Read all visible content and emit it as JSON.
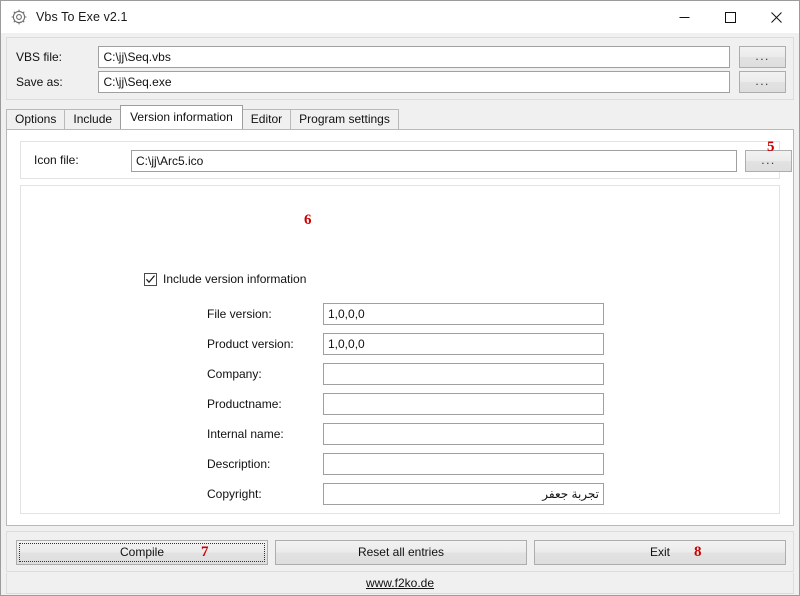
{
  "window": {
    "title": "Vbs To Exe v2.1",
    "icon": "gear-icon",
    "minimize_label": "–",
    "maximize_label": "□",
    "close_label": "✕"
  },
  "top": {
    "vbs_file_label": "VBS file:",
    "vbs_file_value": "C:\\jj\\Seq.vbs",
    "vbs_browse_label": "...",
    "save_as_label": "Save as:",
    "save_as_value": "C:\\jj\\Seq.exe",
    "save_browse_label": "..."
  },
  "tabs": [
    {
      "label": "Options",
      "selected": false
    },
    {
      "label": "Include",
      "selected": false
    },
    {
      "label": "Version information",
      "selected": true
    },
    {
      "label": "Editor",
      "selected": false
    },
    {
      "label": "Program settings",
      "selected": false
    }
  ],
  "version_tab": {
    "icon_file_label": "Icon file:",
    "icon_file_value": "C:\\jj\\Arc5.ico",
    "icon_browse_label": "...",
    "include_version_label": "Include version information",
    "include_version_checked": true,
    "fields": [
      {
        "label": "File version:",
        "value": "1,0,0,0"
      },
      {
        "label": "Product version:",
        "value": "1,0,0,0"
      },
      {
        "label": "Company:",
        "value": ""
      },
      {
        "label": "Productname:",
        "value": ""
      },
      {
        "label": "Internal name:",
        "value": ""
      },
      {
        "label": "Description:",
        "value": ""
      },
      {
        "label": "Copyright:",
        "value": "تجربة جعفر"
      }
    ]
  },
  "bottom": {
    "compile_label": "Compile",
    "reset_label": "Reset all entries",
    "exit_label": "Exit",
    "website": "www.f2ko.de"
  },
  "annotations": [
    {
      "id": "5",
      "text": "5"
    },
    {
      "id": "6",
      "text": "6"
    },
    {
      "id": "7",
      "text": "7"
    },
    {
      "id": "8",
      "text": "8"
    }
  ],
  "colors": {
    "annotation": "#cc0000",
    "window_bg": "#f0f0f0",
    "panel_bg": "#ffffff"
  }
}
